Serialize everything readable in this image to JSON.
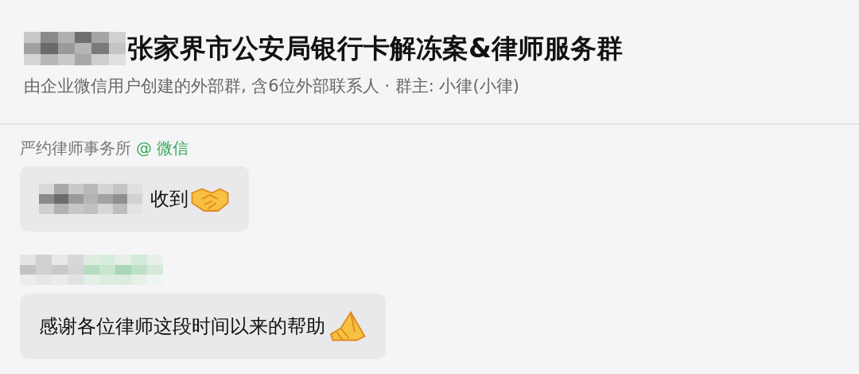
{
  "header": {
    "title_prefix_redacted": true,
    "title": "张家界市公安局银行卡解冻案&律师服务群",
    "subtitle": "由企业微信用户创建的外部群, 含6位外部联系人 · 群主: 小律(小律)"
  },
  "messages": [
    {
      "sender": {
        "redacted": false,
        "name": "严约律师事务所",
        "suffix": "@ 微信"
      },
      "prefix_redacted": true,
      "text": "收到",
      "emoji": {
        "kind": "handshake"
      }
    },
    {
      "sender": {
        "redacted": true
      },
      "prefix_redacted": false,
      "text": "感谢各位律师这段时间以来的帮助",
      "emoji": {
        "kind": "palms"
      }
    }
  ]
}
